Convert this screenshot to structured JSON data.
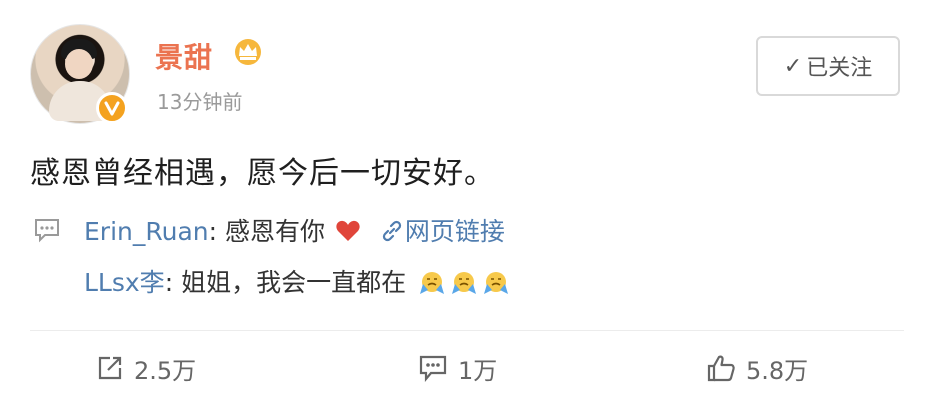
{
  "post": {
    "user": {
      "name": "景甜",
      "time": "13分钟前",
      "badge_icon": "crown-icon",
      "verified_icon": "v-verified-icon"
    },
    "follow_button": {
      "check": "✓",
      "label": "已关注"
    },
    "content": "感恩曾经相遇，愿今后一切安好。",
    "comments": [
      {
        "name": "Erin_Ruan",
        "text": "感恩有你",
        "link_text": "网页链接"
      },
      {
        "name": "LLsx李",
        "text": "姐姐，我会一直都在"
      }
    ],
    "actions": {
      "repost": "2.5万",
      "comment": "1万",
      "like": "5.8万"
    },
    "colors": {
      "username": "#eb7350",
      "link": "#507daf",
      "heart": "#e0453a",
      "badge": "#f4a21f"
    }
  }
}
